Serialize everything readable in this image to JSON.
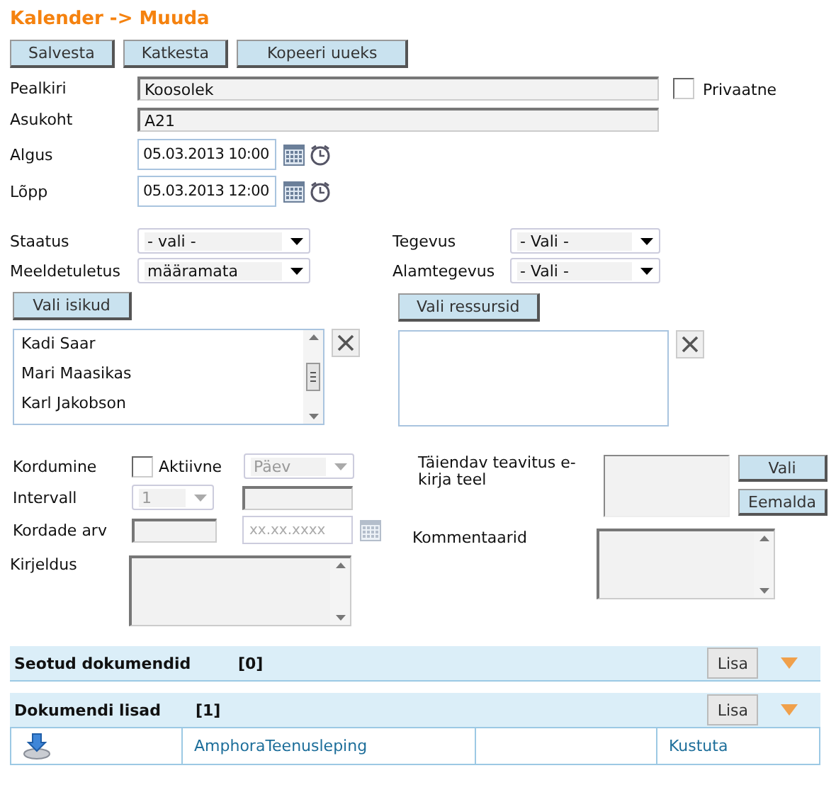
{
  "title": "Kalender -> Muuda",
  "toolbar": [
    "Salvesta",
    "Katkesta",
    "Kopeeri uueks"
  ],
  "main": {
    "subject": {
      "label": "Pealkiri",
      "value": "Koosolek"
    },
    "private": {
      "label": "Privaatne",
      "checked": false
    },
    "location": {
      "label": "Asukoht",
      "value": "A21"
    },
    "start": {
      "label": "Algus",
      "value": "05.03.2013 10:00"
    },
    "end": {
      "label": "Lõpp",
      "value": "05.03.2013 12:00"
    }
  },
  "selects_left": [
    {
      "label": "Staatus",
      "value": "- vali -"
    },
    {
      "label": "Meeldetuletus",
      "value": "määramata"
    }
  ],
  "selects_right": [
    {
      "label": "Tegevus",
      "value": "- Vali -"
    },
    {
      "label": "Alamtegevus",
      "value": "- Vali -"
    }
  ],
  "persons": {
    "button": "Vali isikud",
    "items": [
      "Kadi Saar",
      "Mari Maasikas",
      "Karl Jakobson"
    ]
  },
  "resources": {
    "button": "Vali ressursid"
  },
  "recurrence": {
    "label": "Kordumine",
    "active": {
      "label": "Aktiivne",
      "checked": false
    },
    "period": {
      "value": "Päev",
      "disabled": true
    },
    "interval": {
      "label": "Intervall",
      "value": "1",
      "disabled": true
    },
    "count": {
      "label": "Kordade arv"
    },
    "end_date": {
      "placeholder": "xx.xx.xxxx"
    }
  },
  "notify": {
    "label": "Täiendav teavitus e-kirja teel",
    "buttons": [
      "Vali",
      "Eemalda"
    ]
  },
  "description": {
    "label": "Kirjeldus"
  },
  "comments": {
    "label": "Kommentaarid"
  },
  "sections": [
    {
      "title": "Seotud dokumendid",
      "count": "[0]",
      "button": "Lisa",
      "expanded": true
    },
    {
      "title": "Dokumendi lisad",
      "count": "[1]",
      "button": "Lisa",
      "expanded": true,
      "rows": [
        {
          "name": "AmphoraTeenusleping",
          "action": "Kustuta"
        }
      ]
    }
  ]
}
